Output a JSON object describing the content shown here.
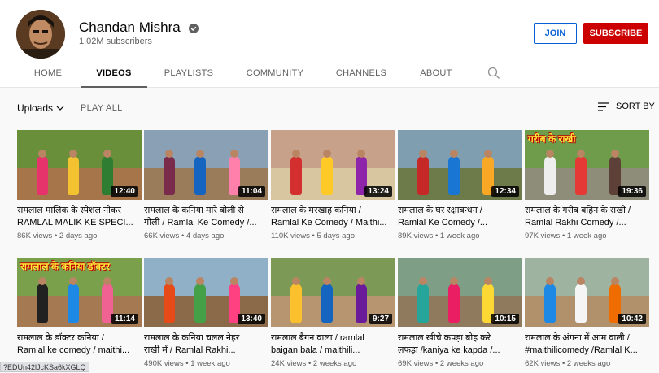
{
  "channel": {
    "name": "Chandan Mishra",
    "subscribers": "1.02M subscribers",
    "join_label": "JOIN",
    "subscribe_label": "SUBSCRIBE"
  },
  "tabs": [
    {
      "label": "HOME"
    },
    {
      "label": "VIDEOS"
    },
    {
      "label": "PLAYLISTS"
    },
    {
      "label": "COMMUNITY"
    },
    {
      "label": "CHANNELS"
    },
    {
      "label": "ABOUT"
    }
  ],
  "toolbar": {
    "uploads_label": "Uploads",
    "play_all_label": "PLAY ALL",
    "sort_label": "SORT BY"
  },
  "videos": [
    {
      "line1": "रामलाल मालिक के स्पेशल नोकर",
      "line2": "RAMLAL MALIK KE SPECI...",
      "views": "86K views",
      "age": "2 days ago",
      "duration": "12:40",
      "overlay": ""
    },
    {
      "line1": "रामलाल के कनिया मारे बोली से",
      "line2": "गोली / Ramlal Ke Comedy /...",
      "views": "66K views",
      "age": "4 days ago",
      "duration": "11:04",
      "overlay": ""
    },
    {
      "line1": "रामलाल के मरखाह कनिया /",
      "line2": "Ramlal Ke Comedy / Maithi...",
      "views": "110K views",
      "age": "5 days ago",
      "duration": "13:24",
      "overlay": ""
    },
    {
      "line1": "रामलाल के घर रक्षाबन्धन /",
      "line2": "Ramlal Ke Comedy /...",
      "views": "89K views",
      "age": "1 week ago",
      "duration": "12:34",
      "overlay": ""
    },
    {
      "line1": "रामलाल के गरीब बहिन के राखी /",
      "line2": "Ramlal Rakhi Comedy /...",
      "views": "97K views",
      "age": "1 week ago",
      "duration": "19:36",
      "overlay": "गरीब के राखी"
    },
    {
      "line1": "रामलाल के डॉक्टर कनिया /",
      "line2": "Ramlal ke comedy / maithi...",
      "views": "",
      "age": "ago",
      "duration": "11:14",
      "overlay": "रामलाल के कनिया डॉक्टर"
    },
    {
      "line1": "रामलाल के कनिया चलल नेहर",
      "line2": "राखी में / Ramlal Rakhi...",
      "views": "490K views",
      "age": "1 week ago",
      "duration": "13:40",
      "overlay": ""
    },
    {
      "line1": "रामलाल बैगन वाला / ramlal",
      "line2": "baigan bala / maithili...",
      "views": "24K views",
      "age": "2 weeks ago",
      "duration": "9:27",
      "overlay": ""
    },
    {
      "line1": "रामलाल खीचे कपड़ा बोह करे",
      "line2": "लफड़ा /kaniya ke kapda /...",
      "views": "69K views",
      "age": "2 weeks ago",
      "duration": "10:15",
      "overlay": ""
    },
    {
      "line1": "रामलाल के अंगना में आम वाली /",
      "line2": "#maithilicomedy /Ramlal K...",
      "views": "62K views",
      "age": "2 weeks ago",
      "duration": "10:42",
      "overlay": ""
    }
  ],
  "status_url": "?EDUn42lJcKSa6kXGLQ"
}
